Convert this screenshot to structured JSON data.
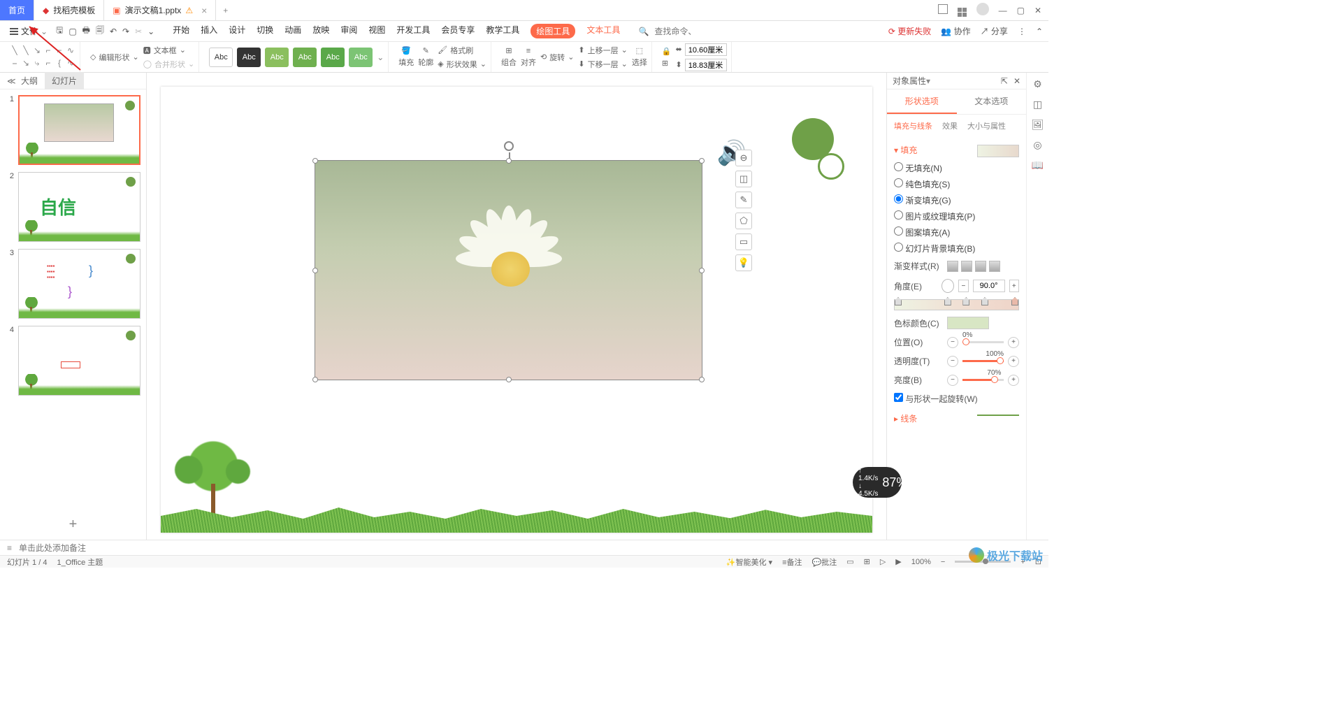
{
  "titlebar": {
    "tab_home": "首页",
    "tab_template": "找稻壳模板",
    "tab_file": "演示文稿1.pptx",
    "add": "+"
  },
  "menubar": {
    "file": "文件",
    "menus": [
      "开始",
      "插入",
      "设计",
      "切换",
      "动画",
      "放映",
      "审阅",
      "视图",
      "开发工具",
      "会员专享",
      "教学工具"
    ],
    "draw_tool": "绘图工具",
    "text_tool": "文本工具",
    "search_placeholder": "查找命令、搜索模板",
    "update_fail": "更新失败",
    "coop": "协作",
    "share": "分享"
  },
  "ribbon": {
    "edit_shape": "编辑形状",
    "textbox": "文本框",
    "merge_shape": "合并形状",
    "abc": "Abc",
    "fill": "填充",
    "outline": "轮廓",
    "shape_effect": "形状效果",
    "format_painter": "格式刷",
    "group": "组合",
    "align": "对齐",
    "rotate": "旋转",
    "move_up": "上移一层",
    "move_down": "下移一层",
    "select": "选择",
    "width_label": "⬌",
    "height_label": "⬍",
    "width": "10.60厘米",
    "height": "18.83厘米"
  },
  "side": {
    "outline": "大纲",
    "slides": "幻灯片",
    "t2_text": "自信"
  },
  "notes_placeholder": "单击此处添加备注",
  "prop": {
    "title": "对象属性",
    "tab_shape": "形状选项",
    "tab_text": "文本选项",
    "sub_fill": "填充与线条",
    "sub_effect": "效果",
    "sub_size": "大小与属性",
    "sec_fill": "填充",
    "r_none": "无填充(N)",
    "r_solid": "纯色填充(S)",
    "r_grad": "渐变填充(G)",
    "r_pic": "图片或纹理填充(P)",
    "r_pattern": "图案填充(A)",
    "r_bg": "幻灯片背景填充(B)",
    "grad_style": "渐变样式(R)",
    "angle": "角度(E)",
    "angle_val": "90.0°",
    "stop_color": "色标颜色(C)",
    "position": "位置(O)",
    "pos_val": "0%",
    "transparency": "透明度(T)",
    "trans_val": "100%",
    "brightness": "亮度(B)",
    "bright_val": "70%",
    "rotate_with": "与形状一起旋转(W)",
    "sec_line": "线条"
  },
  "status": {
    "slide_info": "幻灯片 1 / 4",
    "theme": "1_Office 主题",
    "beautify": "智能美化",
    "notes": "备注",
    "comments": "批注",
    "zoom": "100%"
  },
  "net": {
    "up": "1.4K/s",
    "down": "4.5K/s",
    "pct": "87%"
  },
  "watermark": "极光下载站"
}
